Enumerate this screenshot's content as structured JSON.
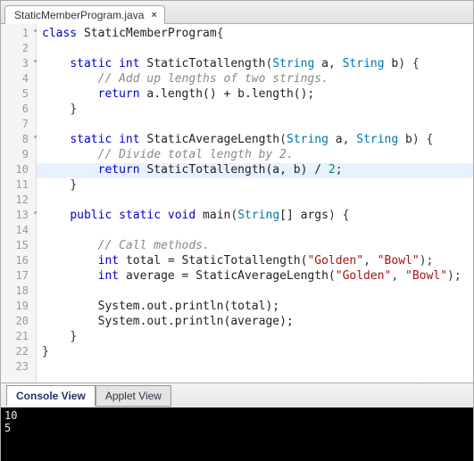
{
  "tab": {
    "filename": "StaticMemberProgram.java",
    "close": "×"
  },
  "gutter": {
    "lines": [
      "1",
      "2",
      "3",
      "4",
      "5",
      "6",
      "7",
      "8",
      "9",
      "10",
      "11",
      "12",
      "13",
      "14",
      "15",
      "16",
      "17",
      "18",
      "19",
      "20",
      "21",
      "22",
      "23"
    ],
    "foldable": [
      1,
      3,
      8,
      13
    ]
  },
  "code": {
    "l1": {
      "kw1": "class",
      "id": " StaticMemberProgram",
      "p": "{"
    },
    "l2": {
      "blank": ""
    },
    "l3": {
      "ind": "    ",
      "kw1": "static ",
      "kw2": "int ",
      "id": "StaticTotallength",
      "p1": "(",
      "t1": "String ",
      "a1": "a",
      "c1": ", ",
      "t2": "String ",
      "a2": "b",
      "p2": ") {"
    },
    "l4": {
      "ind": "        ",
      "cmt": "// Add up lengths of two strings."
    },
    "l5": {
      "ind": "        ",
      "kw": "return ",
      "txt": "a.length() + b.length();"
    },
    "l6": {
      "ind": "    ",
      "p": "}"
    },
    "l7": {
      "blank": ""
    },
    "l8": {
      "ind": "    ",
      "kw1": "static ",
      "kw2": "int ",
      "id": "StaticAverageLength",
      "p1": "(",
      "t1": "String ",
      "a1": "a",
      "c1": ", ",
      "t2": "String ",
      "a2": "b",
      "p2": ") {"
    },
    "l9": {
      "ind": "        ",
      "cmt": "// Divide total length by 2."
    },
    "l10": {
      "ind": "        ",
      "kw": "return ",
      "txt": "StaticTotallength(a, b) / ",
      "num": "2",
      "p": ";"
    },
    "l11": {
      "ind": "    ",
      "p": "}"
    },
    "l12": {
      "blank": ""
    },
    "l13": {
      "ind": "    ",
      "kw1": "public ",
      "kw2": "static ",
      "kw3": "void ",
      "id": "main",
      "p1": "(",
      "t1": "String",
      "arr": "[] ",
      "a1": "args",
      "p2": ") {"
    },
    "l14": {
      "blank": ""
    },
    "l15": {
      "ind": "        ",
      "cmt": "// Call methods."
    },
    "l16": {
      "ind": "        ",
      "kw": "int ",
      "txt1": "total = StaticTotallength(",
      "s1": "\"Golden\"",
      "c1": ", ",
      "s2": "\"Bowl\"",
      "p": ");"
    },
    "l17": {
      "ind": "        ",
      "kw": "int ",
      "txt1": "average = StaticAverageLength(",
      "s1": "\"Golden\"",
      "c1": ", ",
      "s2": "\"Bowl\"",
      "p": ");"
    },
    "l18": {
      "blank": ""
    },
    "l19": {
      "ind": "        ",
      "txt": "System.out.println(total);"
    },
    "l20": {
      "ind": "        ",
      "txt": "System.out.println(average);"
    },
    "l21": {
      "ind": "    ",
      "p": "}"
    },
    "l22": {
      "p": "}"
    },
    "l23": {
      "blank": ""
    }
  },
  "bottom_tabs": {
    "console_view": "Console View",
    "applet_view": "Applet View"
  },
  "console_output": "10\n5"
}
